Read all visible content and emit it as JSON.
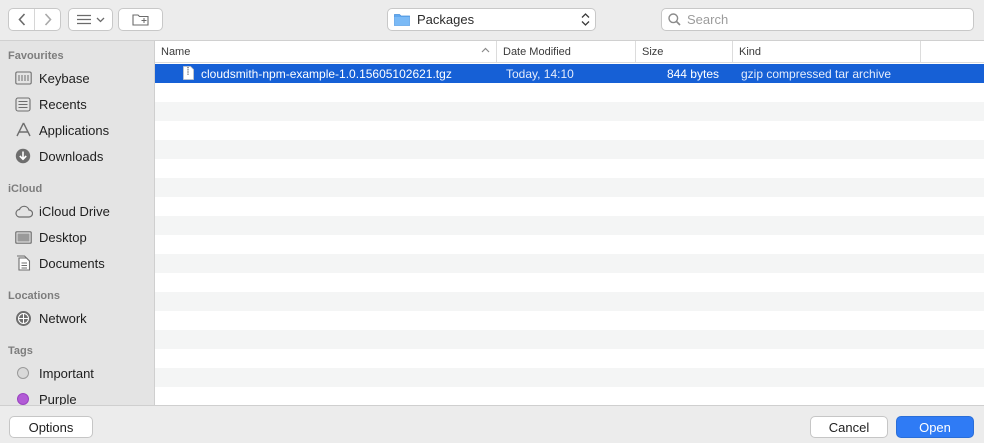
{
  "toolbar": {
    "location": "Packages",
    "search_placeholder": "Search"
  },
  "sidebar": {
    "sections": [
      {
        "title": "Favourites",
        "items": [
          {
            "label": "Keybase",
            "icon": "keybase-folder-icon"
          },
          {
            "label": "Recents",
            "icon": "recents-icon"
          },
          {
            "label": "Applications",
            "icon": "applications-icon"
          },
          {
            "label": "Downloads",
            "icon": "downloads-icon"
          }
        ]
      },
      {
        "title": "iCloud",
        "items": [
          {
            "label": "iCloud Drive",
            "icon": "icloud-icon"
          },
          {
            "label": "Desktop",
            "icon": "desktop-icon"
          },
          {
            "label": "Documents",
            "icon": "documents-icon"
          }
        ]
      },
      {
        "title": "Locations",
        "items": [
          {
            "label": "Network",
            "icon": "network-icon"
          }
        ]
      },
      {
        "title": "Tags",
        "items": [
          {
            "label": "Important",
            "color": "#d9d9d9"
          },
          {
            "label": "Purple",
            "color": "#b25bd6"
          }
        ]
      }
    ]
  },
  "columns": {
    "name": "Name",
    "date": "Date Modified",
    "size": "Size",
    "kind": "Kind"
  },
  "files": [
    {
      "name": "cloudsmith-npm-example-1.0.15605102621.tgz",
      "date": "Today, 14:10",
      "size": "844 bytes",
      "kind": "gzip compressed tar archive",
      "selected": true
    }
  ],
  "buttons": {
    "options": "Options",
    "cancel": "Cancel",
    "open": "Open"
  }
}
